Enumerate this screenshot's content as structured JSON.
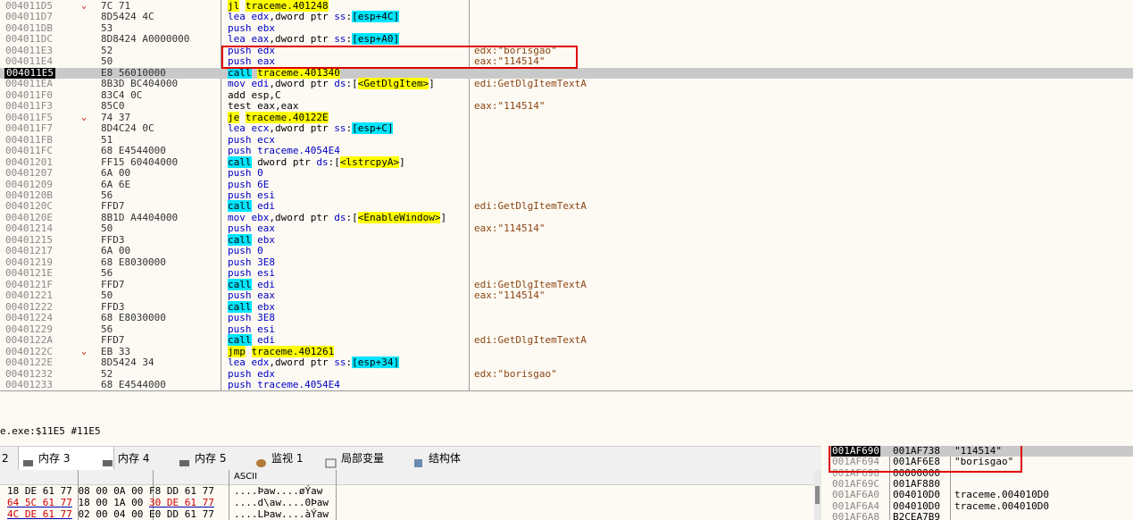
{
  "disasm": [
    {
      "addr": "004011D5",
      "arrow": "⌄",
      "bytes": "7C 71",
      "ins": [
        [
          "jl",
          "y"
        ],
        [
          " ",
          "n"
        ],
        [
          "traceme.401248",
          "hy"
        ]
      ],
      "cmt": ""
    },
    {
      "addr": "004011D7",
      "arrow": "",
      "bytes": "8D5424 4C",
      "ins": [
        [
          "lea ",
          "b"
        ],
        [
          "edx",
          "b"
        ],
        [
          ",dword ptr ",
          "n"
        ],
        [
          "ss",
          "b"
        ],
        [
          ":",
          "n"
        ],
        [
          "[esp+4C]",
          "c"
        ]
      ],
      "cmt": ""
    },
    {
      "addr": "004011DB",
      "arrow": "",
      "bytes": "53",
      "ins": [
        [
          "push ebx",
          "b"
        ]
      ],
      "cmt": ""
    },
    {
      "addr": "004011DC",
      "arrow": "",
      "bytes": "8D8424 A0000000",
      "ins": [
        [
          "lea ",
          "b"
        ],
        [
          "eax",
          "b"
        ],
        [
          ",dword ptr ",
          "n"
        ],
        [
          "ss",
          "b"
        ],
        [
          ":",
          "n"
        ],
        [
          "[esp+A0]",
          "c"
        ]
      ],
      "cmt": ""
    },
    {
      "addr": "004011E3",
      "arrow": "",
      "bytes": "52",
      "ins": [
        [
          "push edx",
          "b"
        ]
      ],
      "cmt": "edx:\"borisgao\""
    },
    {
      "addr": "004011E4",
      "arrow": "",
      "bytes": "50",
      "ins": [
        [
          "push eax",
          "b"
        ]
      ],
      "cmt": "eax:\"114514\""
    },
    {
      "addr": "004011E5",
      "arrow": "",
      "bytes": "E8 56010000",
      "ins": [
        [
          "call",
          "c"
        ],
        [
          " ",
          "n"
        ],
        [
          "traceme.401340",
          "hy"
        ]
      ],
      "cmt": "",
      "cur": true
    },
    {
      "addr": "004011EA",
      "arrow": "",
      "bytes": "8B3D BC404000",
      "ins": [
        [
          "mov ",
          "b"
        ],
        [
          "edi",
          "b"
        ],
        [
          ",dword ptr ",
          "n"
        ],
        [
          "ds",
          "b"
        ],
        [
          ":[",
          "n"
        ],
        [
          "<GetDlgItem>",
          "y"
        ],
        [
          "]",
          "n"
        ]
      ],
      "cmt": "edi:GetDlgItemTextA"
    },
    {
      "addr": "004011F0",
      "arrow": "",
      "bytes": "83C4 0C",
      "ins": [
        [
          "add esp,C",
          "n"
        ]
      ],
      "cmt": ""
    },
    {
      "addr": "004011F3",
      "arrow": "",
      "bytes": "85C0",
      "ins": [
        [
          "test eax,eax",
          "n"
        ]
      ],
      "cmt": "eax:\"114514\""
    },
    {
      "addr": "004011F5",
      "arrow": "⌄",
      "bytes": "74 37",
      "ins": [
        [
          "je",
          "y"
        ],
        [
          " ",
          "n"
        ],
        [
          "traceme.40122E",
          "hy"
        ]
      ],
      "cmt": ""
    },
    {
      "addr": "004011F7",
      "arrow": "",
      "bytes": "8D4C24 0C",
      "ins": [
        [
          "lea ",
          "b"
        ],
        [
          "ecx",
          "b"
        ],
        [
          ",dword ptr ",
          "n"
        ],
        [
          "ss",
          "b"
        ],
        [
          ":",
          "n"
        ],
        [
          "[esp+C]",
          "c"
        ]
      ],
      "cmt": ""
    },
    {
      "addr": "004011FB",
      "arrow": "",
      "bytes": "51",
      "ins": [
        [
          "push ecx",
          "b"
        ]
      ],
      "cmt": ""
    },
    {
      "addr": "004011FC",
      "arrow": "",
      "bytes": "68 E4544000",
      "ins": [
        [
          "push traceme.4054E4",
          "b"
        ]
      ],
      "cmt": ""
    },
    {
      "addr": "00401201",
      "arrow": "",
      "bytes": "FF15 60404000",
      "ins": [
        [
          "call",
          "c"
        ],
        [
          " dword ptr ",
          "n"
        ],
        [
          "ds",
          "b"
        ],
        [
          ":[",
          "n"
        ],
        [
          "<lstrcpyA>",
          "y"
        ],
        [
          "]",
          "n"
        ]
      ],
      "cmt": ""
    },
    {
      "addr": "00401207",
      "arrow": "",
      "bytes": "6A 00",
      "ins": [
        [
          "push 0",
          "b"
        ]
      ],
      "cmt": ""
    },
    {
      "addr": "00401209",
      "arrow": "",
      "bytes": "6A 6E",
      "ins": [
        [
          "push 6E",
          "b"
        ]
      ],
      "cmt": ""
    },
    {
      "addr": "0040120B",
      "arrow": "",
      "bytes": "56",
      "ins": [
        [
          "push esi",
          "b"
        ]
      ],
      "cmt": ""
    },
    {
      "addr": "0040120C",
      "arrow": "",
      "bytes": "FFD7",
      "ins": [
        [
          "call",
          "c"
        ],
        [
          " edi",
          "b"
        ]
      ],
      "cmt": "edi:GetDlgItemTextA"
    },
    {
      "addr": "0040120E",
      "arrow": "",
      "bytes": "8B1D A4404000",
      "ins": [
        [
          "mov ",
          "b"
        ],
        [
          "ebx",
          "b"
        ],
        [
          ",dword ptr ",
          "n"
        ],
        [
          "ds",
          "b"
        ],
        [
          ":[",
          "n"
        ],
        [
          "<EnableWindow>",
          "y"
        ],
        [
          "]",
          "n"
        ]
      ],
      "cmt": ""
    },
    {
      "addr": "00401214",
      "arrow": "",
      "bytes": "50",
      "ins": [
        [
          "push eax",
          "b"
        ]
      ],
      "cmt": "eax:\"114514\""
    },
    {
      "addr": "00401215",
      "arrow": "",
      "bytes": "FFD3",
      "ins": [
        [
          "call",
          "c"
        ],
        [
          " ebx",
          "b"
        ]
      ],
      "cmt": ""
    },
    {
      "addr": "00401217",
      "arrow": "",
      "bytes": "6A 00",
      "ins": [
        [
          "push 0",
          "b"
        ]
      ],
      "cmt": ""
    },
    {
      "addr": "00401219",
      "arrow": "",
      "bytes": "68 E8030000",
      "ins": [
        [
          "push 3E8",
          "b"
        ]
      ],
      "cmt": ""
    },
    {
      "addr": "0040121E",
      "arrow": "",
      "bytes": "56",
      "ins": [
        [
          "push esi",
          "b"
        ]
      ],
      "cmt": ""
    },
    {
      "addr": "0040121F",
      "arrow": "",
      "bytes": "FFD7",
      "ins": [
        [
          "call",
          "c"
        ],
        [
          " edi",
          "b"
        ]
      ],
      "cmt": "edi:GetDlgItemTextA"
    },
    {
      "addr": "00401221",
      "arrow": "",
      "bytes": "50",
      "ins": [
        [
          "push eax",
          "b"
        ]
      ],
      "cmt": "eax:\"114514\""
    },
    {
      "addr": "00401222",
      "arrow": "",
      "bytes": "FFD3",
      "ins": [
        [
          "call",
          "c"
        ],
        [
          " ebx",
          "b"
        ]
      ],
      "cmt": ""
    },
    {
      "addr": "00401224",
      "arrow": "",
      "bytes": "68 E8030000",
      "ins": [
        [
          "push 3E8",
          "b"
        ]
      ],
      "cmt": ""
    },
    {
      "addr": "00401229",
      "arrow": "",
      "bytes": "56",
      "ins": [
        [
          "push esi",
          "b"
        ]
      ],
      "cmt": ""
    },
    {
      "addr": "0040122A",
      "arrow": "",
      "bytes": "FFD7",
      "ins": [
        [
          "call",
          "c"
        ],
        [
          " edi",
          "b"
        ]
      ],
      "cmt": "edi:GetDlgItemTextA"
    },
    {
      "addr": "0040122C",
      "arrow": "⌄",
      "bytes": "EB 33",
      "ins": [
        [
          "jmp",
          "y"
        ],
        [
          " ",
          "n"
        ],
        [
          "traceme.401261",
          "hy"
        ]
      ],
      "cmt": ""
    },
    {
      "addr": "0040122E",
      "arrow": "",
      "bytes": "8D5424 34",
      "ins": [
        [
          "lea ",
          "b"
        ],
        [
          "edx",
          "b"
        ],
        [
          ",dword ptr ",
          "n"
        ],
        [
          "ss",
          "b"
        ],
        [
          ":",
          "n"
        ],
        [
          "[esp+34]",
          "c"
        ]
      ],
      "cmt": ""
    },
    {
      "addr": "00401232",
      "arrow": "",
      "bytes": "52",
      "ins": [
        [
          "push edx",
          "b"
        ]
      ],
      "cmt": "edx:\"borisgao\""
    },
    {
      "addr": "00401233",
      "arrow": "",
      "bytes": "68 E4544000",
      "ins": [
        [
          "push traceme.4054E4",
          "b"
        ]
      ],
      "cmt": ""
    }
  ],
  "status_text": "e.exe:$11E5 #11E5",
  "tabs": [
    {
      "label": "2",
      "active": false
    },
    {
      "label": "内存 3",
      "active": true
    },
    {
      "label": "内存 4",
      "active": false
    },
    {
      "label": "内存 5",
      "active": false
    },
    {
      "label": "监视 1",
      "active": false
    },
    {
      "label": "局部变量",
      "active": false
    },
    {
      "label": "结构体",
      "active": false
    }
  ],
  "dump_header": "ASCII",
  "dump_rows": [
    {
      "g1": "18 DE 61 77",
      "g1red": false,
      "g2": "08 00 0A 00",
      "g3": "F8 DD 61 77",
      "g3red": false,
      "ascii": "....Þaw....øÝaw"
    },
    {
      "g1": "64 5C 61 77",
      "g1red": true,
      "g2": "18 00 1A 00",
      "g3": "30 DE 61 77",
      "g3red": true,
      "ascii": "....d\\aw....0Þaw"
    },
    {
      "g1": "4C DE 61 77",
      "g1red": true,
      "g2": "02 00 04 00",
      "g3": "E0 DD 61 77",
      "g3red": false,
      "ascii": "....LÞaw....àÝaw"
    }
  ],
  "stack": [
    {
      "addr": "001AF690",
      "val": "001AF738",
      "cmt": "\"114514\"",
      "sel": true
    },
    {
      "addr": "001AF694",
      "val": "001AF6E8",
      "cmt": "\"borisgao\"",
      "sel": false
    },
    {
      "addr": "001AF698",
      "val": "00000000",
      "cmt": "",
      "sel": false
    },
    {
      "addr": "001AF69C",
      "val": "001AF880",
      "cmt": "",
      "sel": false
    },
    {
      "addr": "001AF6A0",
      "val": "004010D0",
      "cmt": "traceme.004010D0",
      "sel": false
    },
    {
      "addr": "001AF6A4",
      "val": "004010D0",
      "cmt": "traceme.004010D0",
      "sel": false
    },
    {
      "addr": "001AF6A8",
      "val": "B2CEA7B9",
      "cmt": "",
      "sel": false
    }
  ],
  "colors": {
    "highlight_box": "#e00000",
    "current_row": "#c9c9c9",
    "call_bg": "#00e5ff",
    "jump_bg": "#ffff00"
  },
  "icons": {
    "tab_memory": "memory-icon",
    "tab_watch": "watch-icon",
    "tab_locals": "locals-icon",
    "tab_struct": "struct-icon"
  }
}
